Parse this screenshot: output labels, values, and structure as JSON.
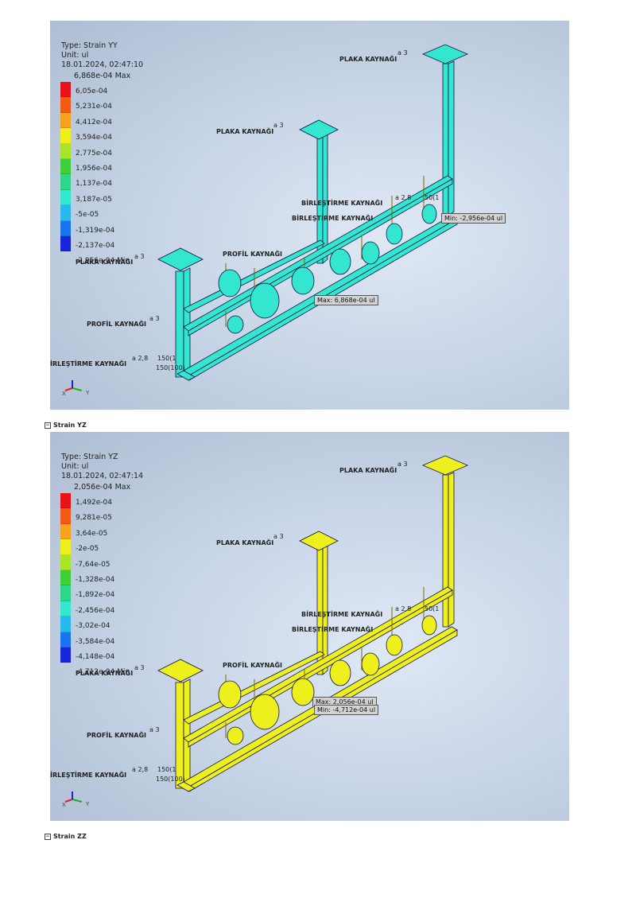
{
  "panels": [
    {
      "type_line": "Type: Strain YY",
      "unit_line": "Unit: ul",
      "date_line": "18.01.2024, 02:47:10",
      "max_label": "6,868e-04 Max",
      "ticks": [
        "6,05e-04",
        "5,231e-04",
        "4,412e-04",
        "3,594e-04",
        "2,775e-04",
        "1,956e-04",
        "1,137e-04",
        "3,187e-05",
        "-5e-05",
        "-1,319e-04",
        "-2,137e-04",
        "-2,956e-04 Min"
      ],
      "body_color": "#33e6d0",
      "probe_max": "Max: 6,868e-04 ul",
      "probe_min": "Min: -2,956e-04 ul"
    },
    {
      "type_line": "Type: Strain YZ",
      "unit_line": "Unit: ul",
      "date_line": "18.01.2024, 02:47:14",
      "max_label": "2,056e-04 Max",
      "ticks": [
        "1,492e-04",
        "9,281e-05",
        "3,64e-05",
        "-2e-05",
        "-7,64e-05",
        "-1,328e-04",
        "-1,892e-04",
        "-2,456e-04",
        "-3,02e-04",
        "-3,584e-04",
        "-4,148e-04",
        "-4,712e-04 Min"
      ],
      "body_color": "#eef01e",
      "probe_max": "Max: 2,056e-04 ul",
      "probe_min": "Min: -4,712e-04 ul"
    }
  ],
  "scale_colors": [
    "#e8121a",
    "#f05a14",
    "#f7a21e",
    "#eef01e",
    "#a6e52a",
    "#3fcf3a",
    "#2fd58a",
    "#33e6d0",
    "#28b8ec",
    "#1b74ee",
    "#1726d8"
  ],
  "weld_labels": {
    "plate": "PLAKA KAYNAĞI",
    "profile": "PROFİL KAYNAĞI",
    "profile_upper": "PROFİL KAYNAĞI",
    "joint": "BİRLEŞTİRME KAYNAĞI",
    "joint_left": "İRLEŞTİRME KAYNAĞI",
    "a3": "a 3",
    "a28": "a 2,8",
    "len150": "150(1",
    "len150b": "150(100)",
    "len50": "50(1"
  },
  "axis": {
    "x": "X",
    "y": "Y",
    "z": "Z"
  },
  "sections": [
    "Strain YZ",
    "Strain ZZ"
  ]
}
